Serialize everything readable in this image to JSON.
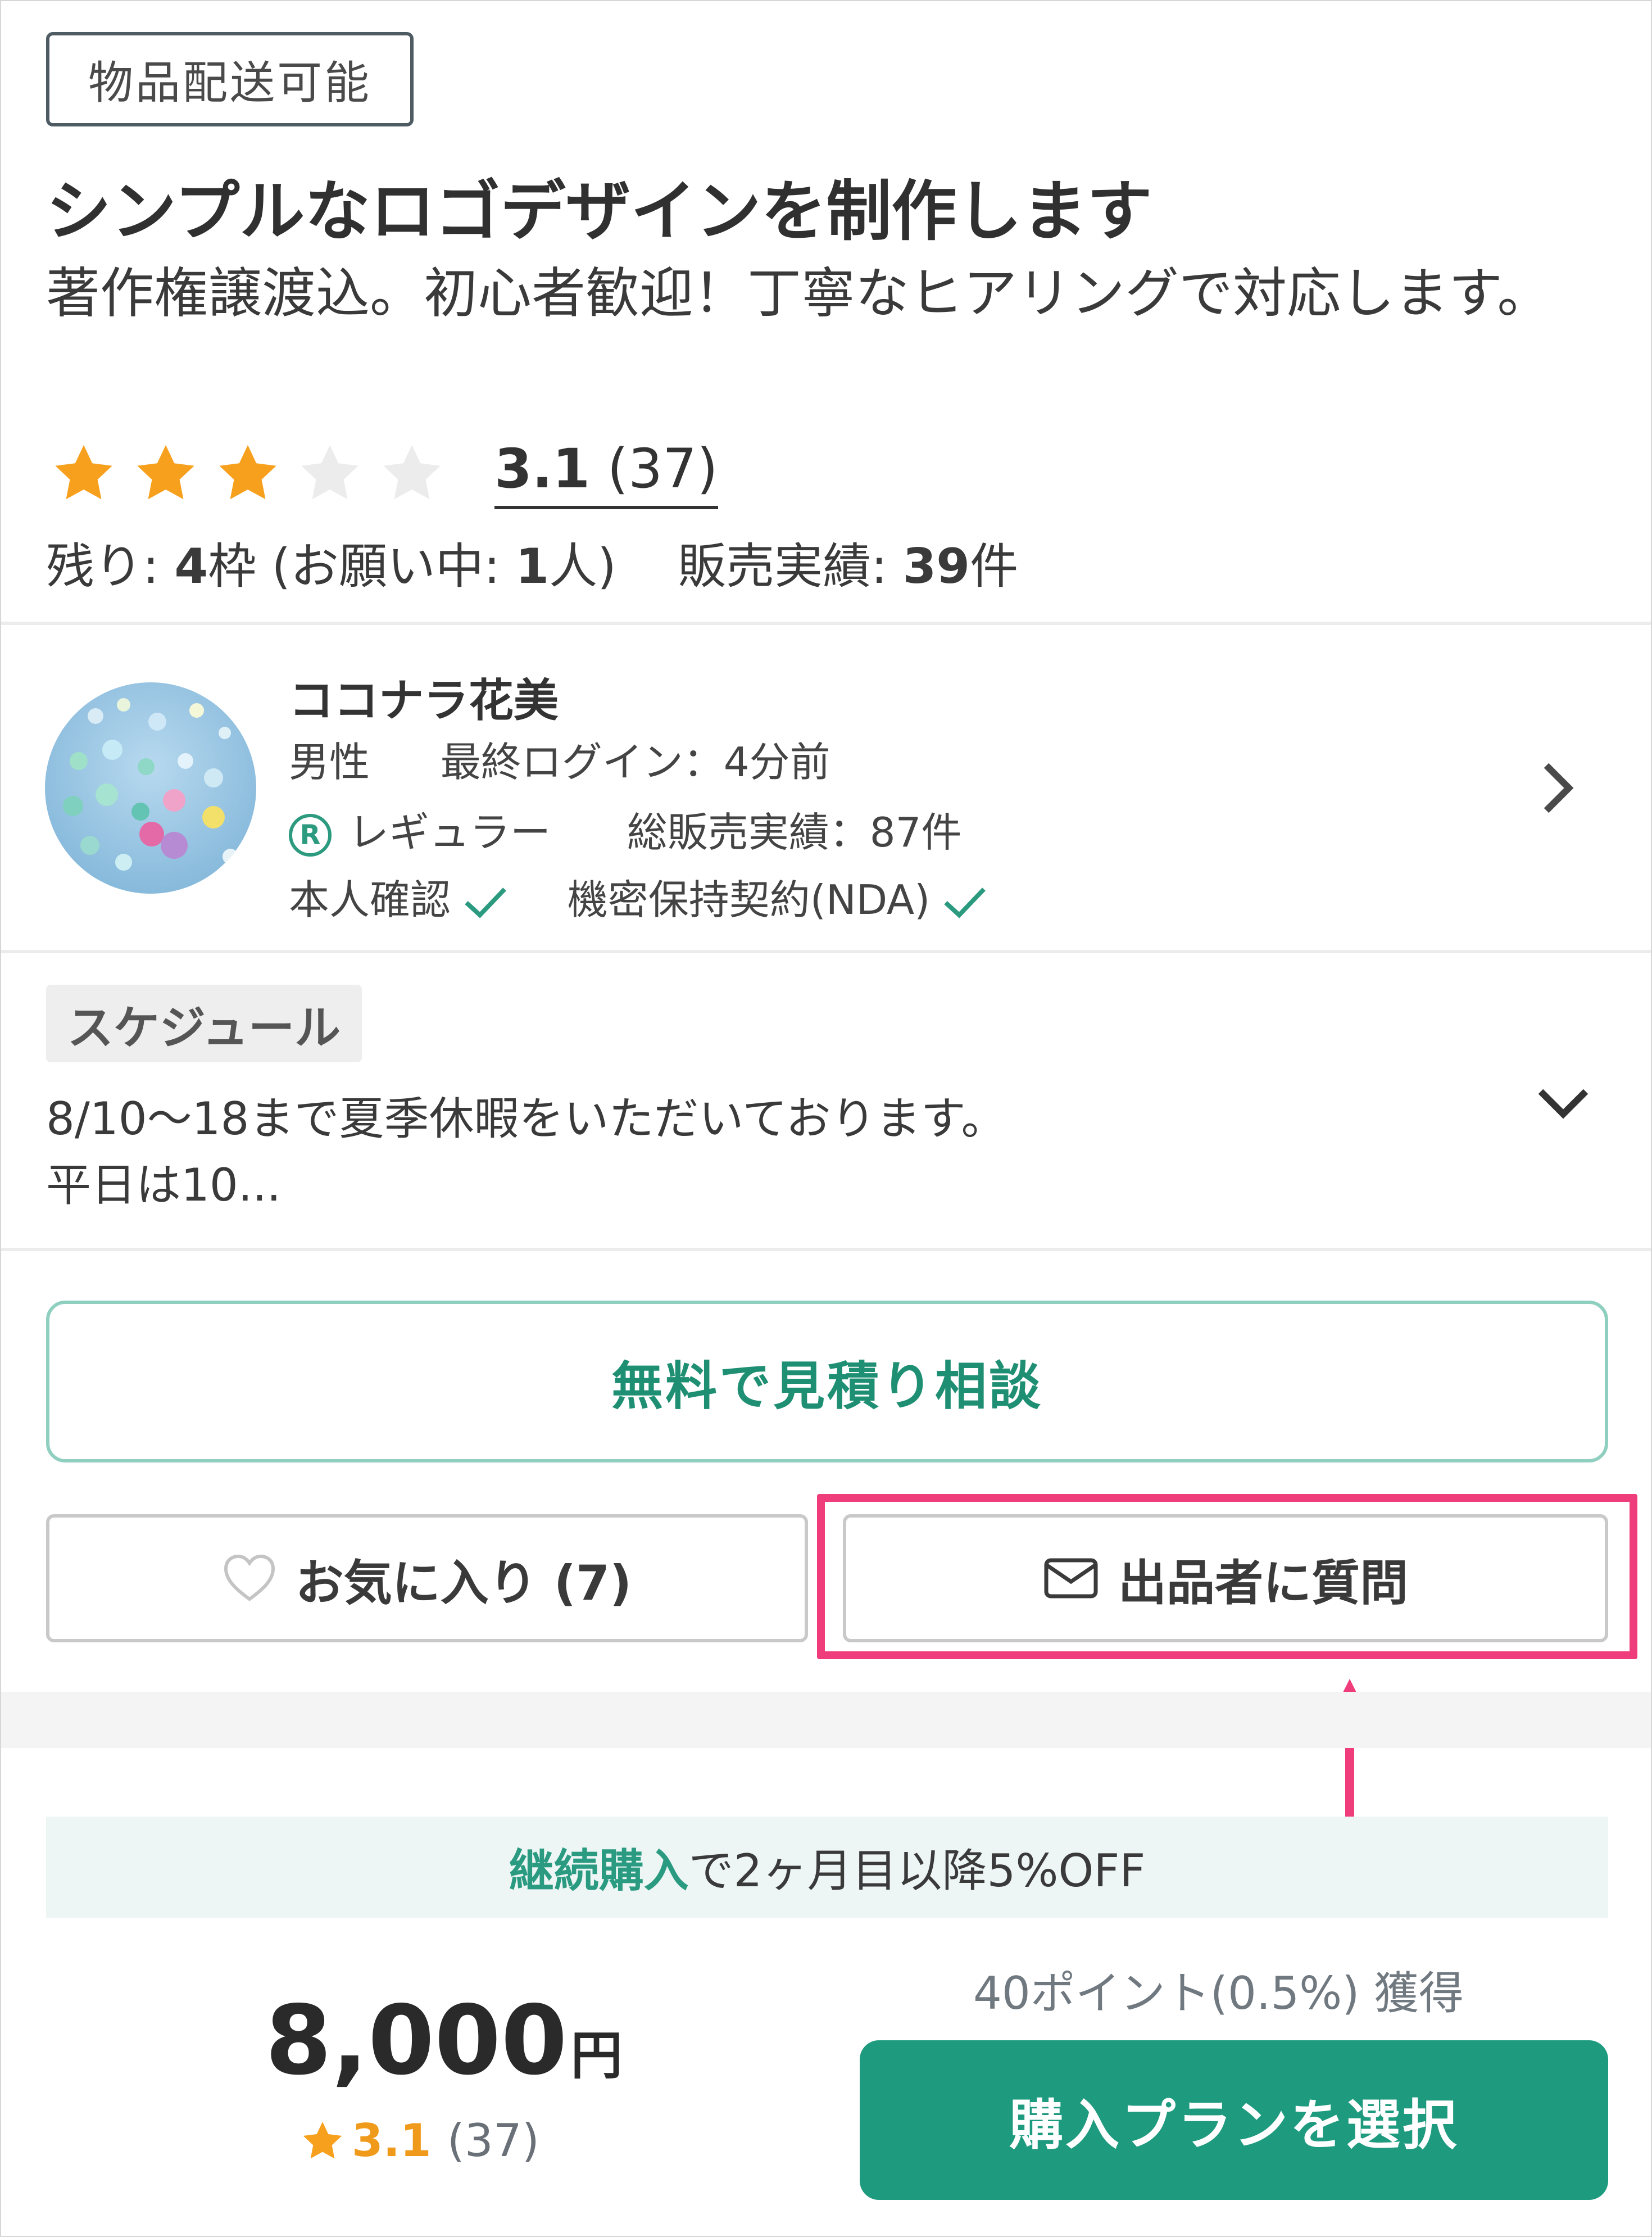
{
  "shipping_badge": "物品配送可能",
  "title": "シンプルなロゴデザインを制作します",
  "subtitle": "著作権譲渡込。初心者歓迎！丁寧なヒアリングで対応します。",
  "rating": {
    "score": "3.1",
    "count": "(37)",
    "stars_filled": 3,
    "stars_total": 5
  },
  "stock": {
    "remaining_label": "残り: ",
    "remaining_value": "4",
    "remaining_unit": "枠",
    "requests_label": " (お願い中: ",
    "requests_value": "1",
    "requests_unit": "人)",
    "sales_label": "販売実績: ",
    "sales_value": "39",
    "sales_unit": "件"
  },
  "seller": {
    "name": "ココナラ花美",
    "gender": "男性",
    "last_login": "最終ログイン：4分前",
    "rank_icon": "R",
    "rank": "レギュラー",
    "total_sales": "総販売実績：87件",
    "identity_verified": "本人確認",
    "nda": "機密保持契約(NDA)"
  },
  "schedule": {
    "tag": "スケジュール",
    "line1": "8/10〜18まで夏季休暇をいただいております。",
    "line2": "平日は10..."
  },
  "buttons": {
    "consult": "無料で見積り相談",
    "favorite": "お気に入り (7)",
    "question": "出品者に質問",
    "buy": "購入プランを選択"
  },
  "promo": {
    "highlight": "継続購入",
    "text": "で2ヶ月目以降5%OFF"
  },
  "points": "40ポイント(0.5%) 獲得",
  "price": {
    "amount": "8,000",
    "unit": "円"
  },
  "mini_rating": {
    "score": "3.1",
    "count": "(37)"
  },
  "colors": {
    "accent": "#1e9a7f",
    "star": "#f7a01d",
    "highlight": "#ef3c7a"
  },
  "icons": [
    "star-icon",
    "registered-icon",
    "check-icon",
    "chevron-right-icon",
    "chevron-down-icon",
    "heart-icon",
    "mail-icon",
    "arrow-up-icon"
  ]
}
